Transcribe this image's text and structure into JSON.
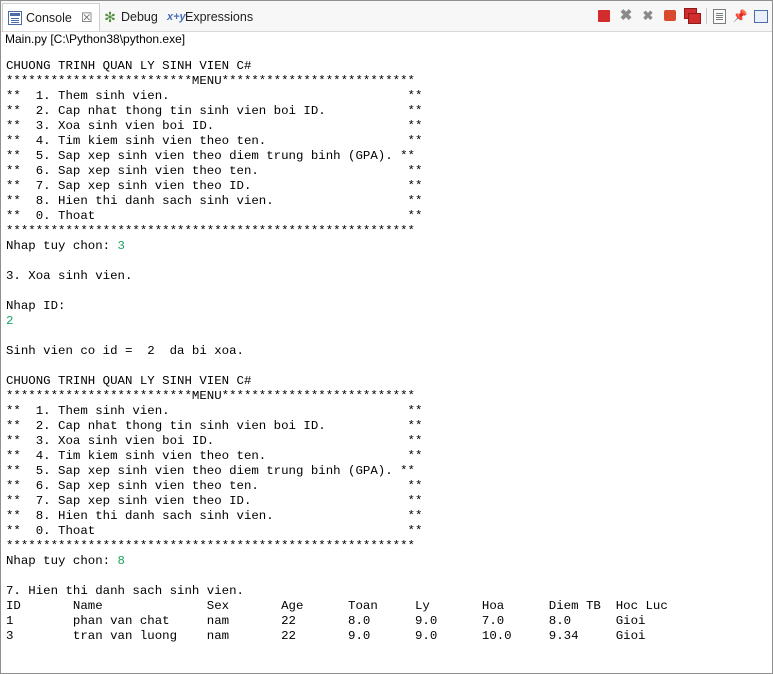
{
  "tabs": {
    "console": "Console",
    "console_close": "☒",
    "debug": "Debug",
    "expressions": "Expressions"
  },
  "process_label": "Main.py [C:\\Python38\\python.exe]",
  "lines": {
    "l0": "CHUONG TRINH QUAN LY SINH VIEN C#",
    "l1": "*************************MENU**************************",
    "l2": "**  1. Them sinh vien.                                **",
    "l3": "**  2. Cap nhat thong tin sinh vien boi ID.           **",
    "l4": "**  3. Xoa sinh vien boi ID.                          **",
    "l5": "**  4. Tim kiem sinh vien theo ten.                   **",
    "l6": "**  5. Sap xep sinh vien theo diem trung binh (GPA). **",
    "l7": "**  6. Sap xep sinh vien theo ten.                    **",
    "l8": "**  7. Sap xep sinh vien theo ID.                     **",
    "l9": "**  8. Hien thi danh sach sinh vien.                  **",
    "l10": "**  0. Thoat                                          **",
    "l11": "*******************************************************",
    "l12": "Nhap tuy chon: ",
    "l12_in": "3",
    "l14": "3. Xoa sinh vien.",
    "l16": "Nhap ID:",
    "l17_in": "2",
    "l19": "Sinh vien co id =  2  da bi xoa.",
    "l21": "CHUONG TRINH QUAN LY SINH VIEN C#",
    "l22": "*************************MENU**************************",
    "l23": "**  1. Them sinh vien.                                **",
    "l24": "**  2. Cap nhat thong tin sinh vien boi ID.           **",
    "l25": "**  3. Xoa sinh vien boi ID.                          **",
    "l26": "**  4. Tim kiem sinh vien theo ten.                   **",
    "l27": "**  5. Sap xep sinh vien theo diem trung binh (GPA). **",
    "l28": "**  6. Sap xep sinh vien theo ten.                    **",
    "l29": "**  7. Sap xep sinh vien theo ID.                     **",
    "l30": "**  8. Hien thi danh sach sinh vien.                  **",
    "l31": "**  0. Thoat                                          **",
    "l32": "*******************************************************",
    "l33": "Nhap tuy chon: ",
    "l33_in": "8",
    "l35": "7. Hien thi danh sach sinh vien.",
    "l36": "ID       Name              Sex       Age      Toan     Ly       Hoa      Diem TB  Hoc Luc",
    "l37": "1        phan van chat     nam       22       8.0      9.0      7.0      8.0      Gioi",
    "l38": "3        tran van luong    nam       22       9.0      9.0      10.0     9.34     Gioi"
  },
  "toolbar_icons": [
    "terminate-icon",
    "remove-launch-icon",
    "remove-all-icon",
    "stop-red-icon",
    "console-windows-icon",
    "scroll-lock-icon",
    "pin-console-icon",
    "display-console-icon"
  ],
  "colors": {
    "input": "#1aa260",
    "stop": "#d42c2c"
  }
}
